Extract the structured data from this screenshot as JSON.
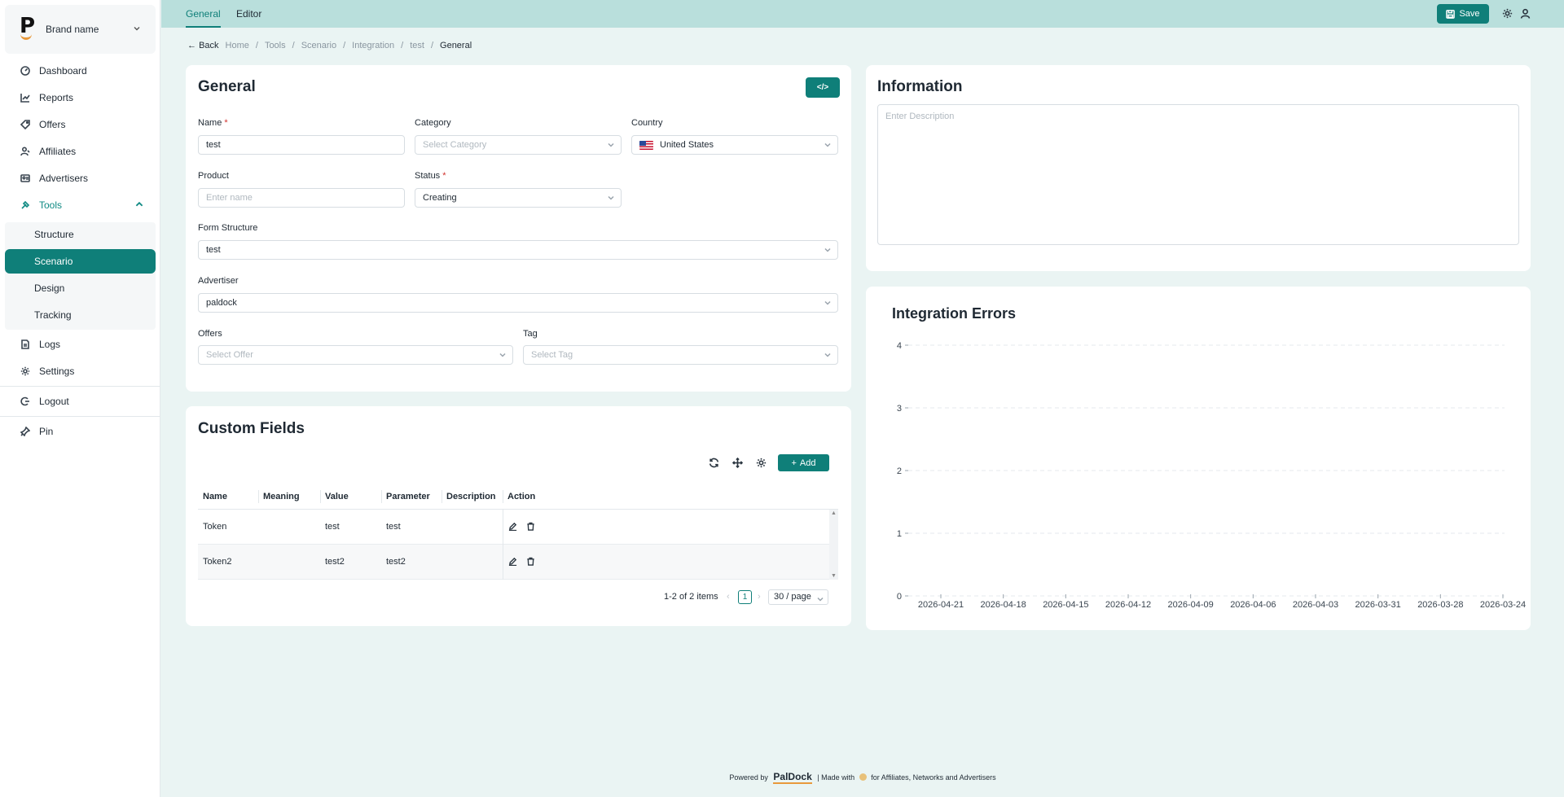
{
  "sidebar": {
    "brand_name": "Brand name",
    "items": [
      {
        "label": "Dashboard",
        "icon": "dashboard-icon"
      },
      {
        "label": "Reports",
        "icon": "reports-icon"
      },
      {
        "label": "Offers",
        "icon": "tag-icon"
      },
      {
        "label": "Affiliates",
        "icon": "affiliates-icon"
      },
      {
        "label": "Advertisers",
        "icon": "advertisers-icon"
      },
      {
        "label": "Tools",
        "icon": "tools-icon",
        "expanded": true
      }
    ],
    "tools_submenu": [
      {
        "label": "Structure"
      },
      {
        "label": "Scenario",
        "active": true
      },
      {
        "label": "Design"
      },
      {
        "label": "Tracking"
      }
    ],
    "bottom_items": [
      {
        "label": "Logs",
        "icon": "logs-icon"
      },
      {
        "label": "Settings",
        "icon": "gear-icon"
      },
      {
        "label": "Logout",
        "icon": "logout-icon"
      },
      {
        "label": "Pin",
        "icon": "pin-icon"
      }
    ]
  },
  "topbar": {
    "tabs": [
      {
        "label": "General",
        "active": true
      },
      {
        "label": "Editor"
      }
    ],
    "save_label": "Save"
  },
  "breadcrumb": {
    "back": "Back",
    "items": [
      "Home",
      "Tools",
      "Scenario",
      "Integration",
      "test"
    ],
    "current": "General"
  },
  "general": {
    "title": "General",
    "code_label": "</>",
    "name_label": "Name",
    "name_value": "test",
    "category_label": "Category",
    "category_placeholder": "Select Category",
    "country_label": "Country",
    "country_value": "United States",
    "product_label": "Product",
    "product_placeholder": "Enter name",
    "status_label": "Status",
    "status_value": "Creating",
    "form_structure_label": "Form Structure",
    "form_structure_value": "test",
    "advertiser_label": "Advertiser",
    "advertiser_value": "paldock",
    "offers_label": "Offers",
    "offers_placeholder": "Select Offer",
    "tag_label": "Tag",
    "tag_placeholder": "Select Tag",
    "required_mark": "*"
  },
  "information": {
    "title": "Information",
    "description_placeholder": "Enter Description"
  },
  "custom_fields": {
    "title": "Custom Fields",
    "add_label": "Add",
    "columns": [
      "Name",
      "Meaning",
      "Value",
      "Parameter",
      "Description",
      "Action"
    ],
    "rows": [
      {
        "name": "Token",
        "meaning": "",
        "value": "test",
        "parameter": "test",
        "description": ""
      },
      {
        "name": "Token2",
        "meaning": "",
        "value": "test2",
        "parameter": "test2",
        "description": ""
      }
    ],
    "pagination": {
      "summary": "1-2 of 2 items",
      "page": "1",
      "page_size": "30 / page"
    }
  },
  "errors_card": {
    "title": "Integration Errors"
  },
  "chart_data": {
    "type": "line",
    "title": "Integration Errors",
    "x": [
      "2026-04-21",
      "2026-04-18",
      "2026-04-15",
      "2026-04-12",
      "2026-04-09",
      "2026-04-06",
      "2026-04-03",
      "2026-03-31",
      "2026-03-28",
      "2026-03-24"
    ],
    "y_ticks": [
      0,
      1,
      2,
      3,
      4
    ],
    "ylim": [
      0,
      4
    ],
    "series": [],
    "grid": true
  },
  "footer": {
    "powered_by": "Powered by",
    "brand": "PalDock",
    "separator": "|",
    "made_with": "Made with",
    "tagline": "for Affiliates, Networks and Advertisers"
  }
}
